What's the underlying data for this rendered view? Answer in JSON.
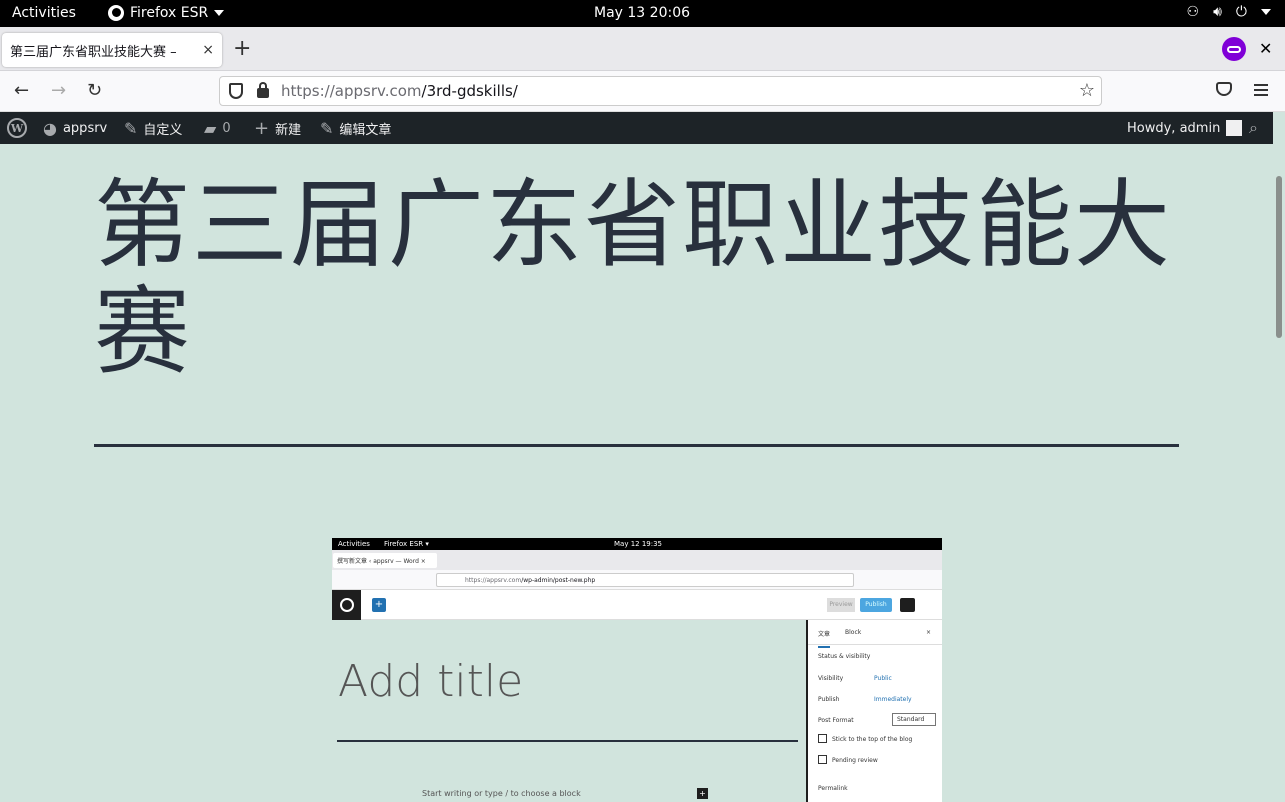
{
  "gnome": {
    "activities": "Activities",
    "app_name": "Firefox ESR",
    "clock": "May 13  20:06"
  },
  "browser": {
    "tab_title": "第三届广东省职业技能大赛 –",
    "tab_close": "×",
    "new_tab": "+",
    "window_close": "✕",
    "url_domain": "https://appsrv.com",
    "url_path": "/3rd-gdskills/",
    "bookmark_star": "☆",
    "back": "←",
    "forward": "→",
    "reload": "↻"
  },
  "adminbar": {
    "site_name": "appsrv",
    "customize": "自定义",
    "comments_count": "0",
    "new": "新建",
    "edit_post": "编辑文章",
    "howdy": "Howdy, admin"
  },
  "page": {
    "title": "第三届广东省职业技能大赛"
  },
  "embedded_screenshot": {
    "activities": "Activities",
    "app_name": "Firefox ESR ▾",
    "clock": "May 12  19:35",
    "tab_title": "撰写新文章 ‹ appsrv — Word ×",
    "url_domain": "https://appsrv.com",
    "url_path": "/wp-admin/post-new.php",
    "preview": "Preview",
    "publish": "Publish",
    "title_placeholder": "Add title",
    "block_prompt": "Start writing or type / to choose a block",
    "sidebar": {
      "tab_post": "文章",
      "tab_block": "Block",
      "close": "×",
      "section": "Status & visibility",
      "visibility_label": "Visibility",
      "visibility_value": "Public",
      "publish_label": "Publish",
      "publish_value": "Immediately",
      "format_label": "Post Format",
      "format_value": "Standard",
      "stick": "Stick to the top of the blog",
      "pending": "Pending review",
      "permalink": "Permalink"
    }
  },
  "colors": {
    "background": "#d1e4dd",
    "text": "#28303d",
    "adminbar": "#1d2327"
  }
}
